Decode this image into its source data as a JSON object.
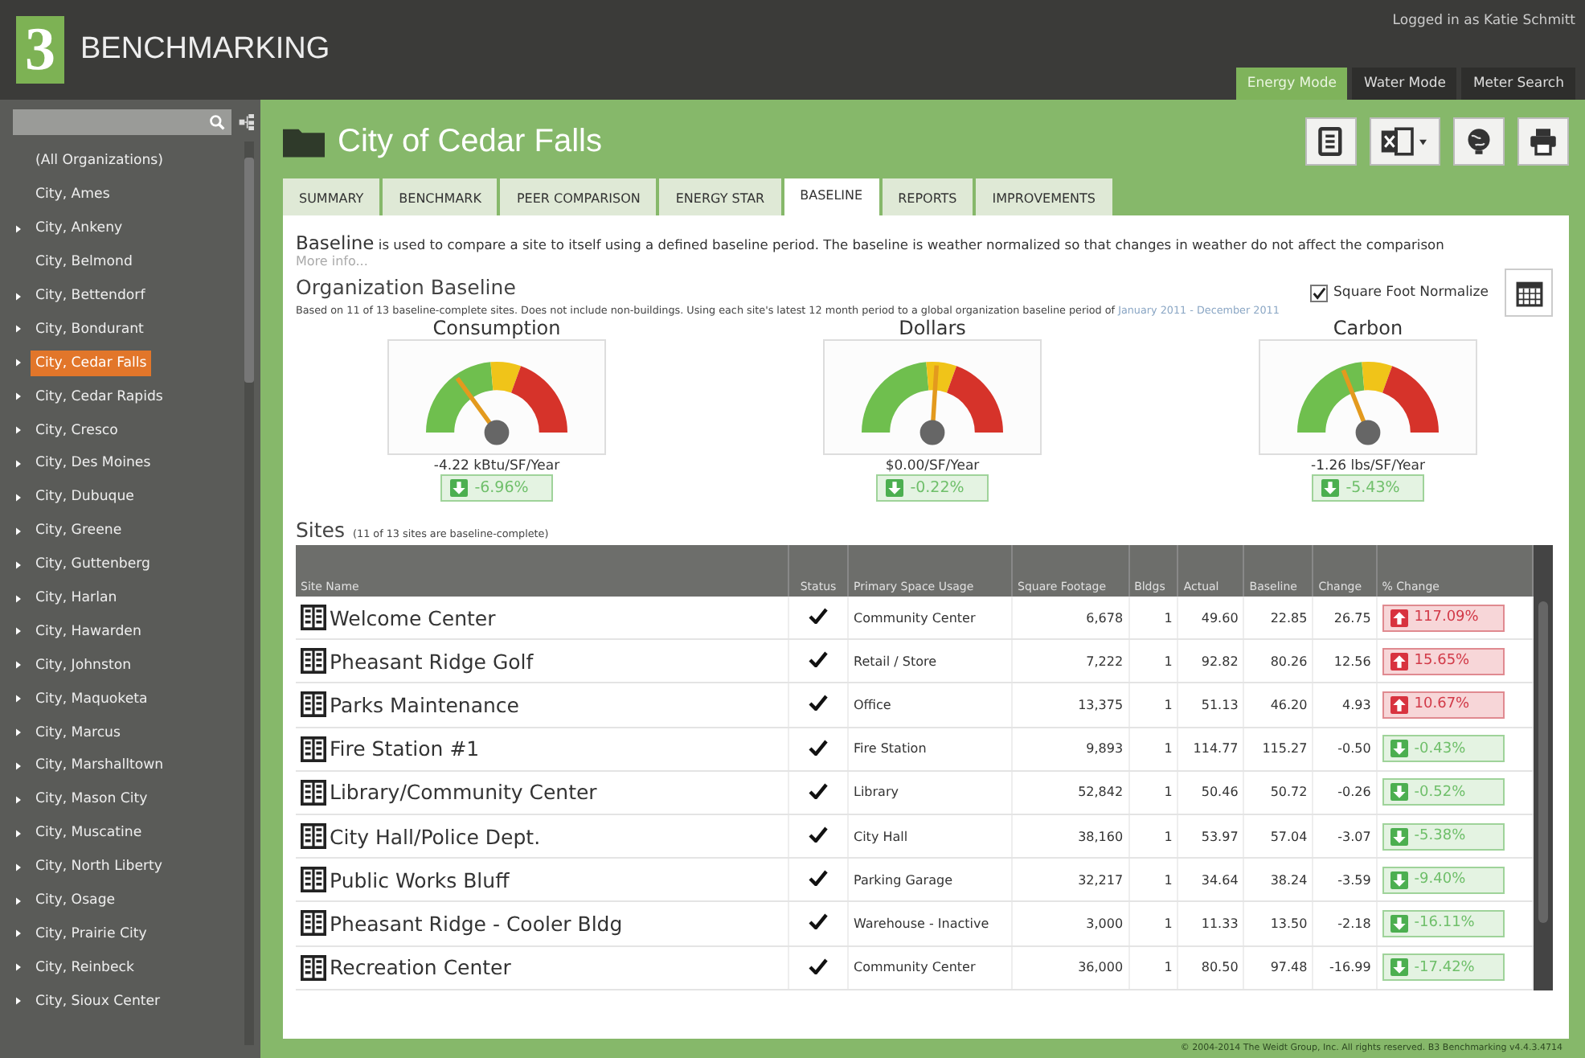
{
  "app": {
    "logo": "3",
    "title": "BENCHMARKING",
    "user": "Logged in as Katie Schmitt"
  },
  "modes": [
    {
      "label": "Energy Mode",
      "selected": true
    },
    {
      "label": "Water Mode",
      "selected": false
    },
    {
      "label": "Meter Search",
      "selected": false
    }
  ],
  "sidebar": {
    "items": [
      {
        "label": "(All Organizations)",
        "has_children": false,
        "selected": false
      },
      {
        "label": "City, Ames",
        "has_children": false,
        "selected": false
      },
      {
        "label": "City, Ankeny",
        "has_children": true,
        "selected": false
      },
      {
        "label": "City, Belmond",
        "has_children": false,
        "selected": false
      },
      {
        "label": "City, Bettendorf",
        "has_children": true,
        "selected": false
      },
      {
        "label": "City, Bondurant",
        "has_children": true,
        "selected": false
      },
      {
        "label": "City, Cedar Falls",
        "has_children": true,
        "selected": true
      },
      {
        "label": "City, Cedar Rapids",
        "has_children": true,
        "selected": false
      },
      {
        "label": "City, Cresco",
        "has_children": true,
        "selected": false
      },
      {
        "label": "City, Des Moines",
        "has_children": true,
        "selected": false
      },
      {
        "label": "City, Dubuque",
        "has_children": true,
        "selected": false
      },
      {
        "label": "City, Greene",
        "has_children": true,
        "selected": false
      },
      {
        "label": "City, Guttenberg",
        "has_children": true,
        "selected": false
      },
      {
        "label": "City, Harlan",
        "has_children": true,
        "selected": false
      },
      {
        "label": "City, Hawarden",
        "has_children": true,
        "selected": false
      },
      {
        "label": "City, Johnston",
        "has_children": true,
        "selected": false
      },
      {
        "label": "City, Maquoketa",
        "has_children": true,
        "selected": false
      },
      {
        "label": "City, Marcus",
        "has_children": true,
        "selected": false
      },
      {
        "label": "City, Marshalltown",
        "has_children": true,
        "selected": false
      },
      {
        "label": "City, Mason City",
        "has_children": true,
        "selected": false
      },
      {
        "label": "City, Muscatine",
        "has_children": true,
        "selected": false
      },
      {
        "label": "City, North Liberty",
        "has_children": true,
        "selected": false
      },
      {
        "label": "City, Osage",
        "has_children": true,
        "selected": false
      },
      {
        "label": "City, Prairie City",
        "has_children": true,
        "selected": false
      },
      {
        "label": "City, Reinbeck",
        "has_children": true,
        "selected": false
      },
      {
        "label": "City, Sioux Center",
        "has_children": true,
        "selected": false
      }
    ]
  },
  "page": {
    "title": "City of Cedar Falls"
  },
  "tabs": [
    {
      "label": "SUMMARY",
      "selected": false
    },
    {
      "label": "BENCHMARK",
      "selected": false
    },
    {
      "label": "PEER COMPARISON",
      "selected": false
    },
    {
      "label": "ENERGY STAR",
      "selected": false
    },
    {
      "label": "BASELINE",
      "selected": true
    },
    {
      "label": "REPORTS",
      "selected": false
    },
    {
      "label": "IMPROVEMENTS",
      "selected": false
    }
  ],
  "intro": {
    "term": "Baseline",
    "text": "is used to compare a site to itself using a defined baseline period. The baseline is weather normalized so that changes in weather do not affect the comparison",
    "more": "More info..."
  },
  "org_baseline": {
    "title": "Organization Baseline",
    "note": "Based on 11 of 13 baseline-complete sites. Does not include non-buildings. Using each site's latest 12 month period to a global organization baseline period of",
    "period": "January 2011 - December 2011",
    "normalize": {
      "label": "Square Foot Normalize",
      "checked": true
    }
  },
  "gauges": [
    {
      "title": "Consumption",
      "reading": "-4.22 kBtu/SF/Year",
      "change": "-6.96%",
      "kind": "down"
    },
    {
      "title": "Dollars",
      "reading": "$0.00/SF/Year",
      "change": "-0.22%",
      "kind": "down"
    },
    {
      "title": "Carbon",
      "reading": "-1.26 lbs/SF/Year",
      "change": "-5.43%",
      "kind": "down"
    }
  ],
  "sites": {
    "title": "Sites",
    "note": "(11 of 13 sites are baseline-complete)",
    "columns": [
      "Site Name",
      "Status",
      "Primary Space Usage",
      "Square Footage",
      "Bldgs",
      "Actual",
      "Baseline",
      "Change",
      "% Change"
    ],
    "rows": [
      {
        "name": "Welcome Center",
        "complete": true,
        "usage": "Community Center",
        "sqft": "6,678",
        "bldgs": "1",
        "actual": "49.60",
        "baseline": "22.85",
        "change": "26.75",
        "pct": "117.09%",
        "kind": "up"
      },
      {
        "name": "Pheasant Ridge Golf",
        "complete": true,
        "usage": "Retail / Store",
        "sqft": "7,222",
        "bldgs": "1",
        "actual": "92.82",
        "baseline": "80.26",
        "change": "12.56",
        "pct": "15.65%",
        "kind": "up"
      },
      {
        "name": "Parks Maintenance",
        "complete": true,
        "usage": "Office",
        "sqft": "13,375",
        "bldgs": "1",
        "actual": "51.13",
        "baseline": "46.20",
        "change": "4.93",
        "pct": "10.67%",
        "kind": "up"
      },
      {
        "name": "Fire Station #1",
        "complete": true,
        "usage": "Fire Station",
        "sqft": "9,893",
        "bldgs": "1",
        "actual": "114.77",
        "baseline": "115.27",
        "change": "-0.50",
        "pct": "-0.43%",
        "kind": "down"
      },
      {
        "name": "Library/Community Center",
        "complete": true,
        "usage": "Library",
        "sqft": "52,842",
        "bldgs": "1",
        "actual": "50.46",
        "baseline": "50.72",
        "change": "-0.26",
        "pct": "-0.52%",
        "kind": "down"
      },
      {
        "name": "City Hall/Police Dept.",
        "complete": true,
        "usage": "City Hall",
        "sqft": "38,160",
        "bldgs": "1",
        "actual": "53.97",
        "baseline": "57.04",
        "change": "-3.07",
        "pct": "-5.38%",
        "kind": "down"
      },
      {
        "name": "Public Works Bluff",
        "complete": true,
        "usage": "Parking Garage",
        "sqft": "32,217",
        "bldgs": "1",
        "actual": "34.64",
        "baseline": "38.24",
        "change": "-3.59",
        "pct": "-9.40%",
        "kind": "down"
      },
      {
        "name": "Pheasant Ridge - Cooler Bldg",
        "complete": true,
        "usage": "Warehouse - Inactive",
        "sqft": "3,000",
        "bldgs": "1",
        "actual": "11.33",
        "baseline": "13.50",
        "change": "-2.18",
        "pct": "-16.11%",
        "kind": "down"
      },
      {
        "name": "Recreation Center",
        "complete": true,
        "usage": "Community Center",
        "sqft": "36,000",
        "bldgs": "1",
        "actual": "80.50",
        "baseline": "97.48",
        "change": "-16.99",
        "pct": "-17.42%",
        "kind": "down"
      }
    ]
  },
  "footer": "© 2004-2014 The Weidt Group, Inc. All rights reserved. B3 Benchmarking v4.4.3.4714"
}
